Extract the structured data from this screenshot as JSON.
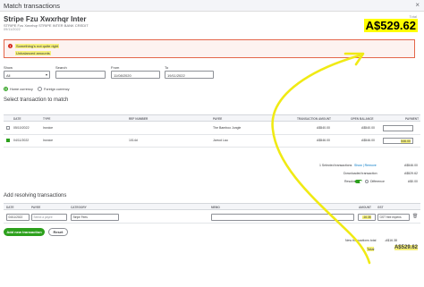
{
  "window": {
    "title": "Match transactions",
    "close": "×"
  },
  "header": {
    "account_title": "Stripe Fzu Xwxrhqr Inter",
    "description": "STRIPE Fzu Xwxrhqr STRIPE INTER BANK CREDIT",
    "date": "09/11/2022",
    "total_label": "Total",
    "total_amount": "A$529.62"
  },
  "alert": {
    "icon": "!",
    "line1": "Something's not quite right",
    "line2": "Unbalanced amounts"
  },
  "filters": {
    "show_label": "Show",
    "show_value": "All",
    "search_label": "Search",
    "search_placeholder": "",
    "from_label": "From",
    "from_value": "11/08/2020",
    "to_label": "To",
    "to_value": "19/11/2022",
    "currency_home": "Home currency",
    "currency_foreign": "Foreign currency"
  },
  "match": {
    "section_title": "Select transaction to match",
    "columns": [
      "DATE",
      "TYPE",
      "REF NUMBER",
      "PAYEE",
      "TRANSACTION AMOUNT",
      "OPEN BALANCE",
      "PAYMENT"
    ],
    "rows": [
      {
        "date": "05/10/2022",
        "type": "Invoice",
        "ref": "",
        "payee": "The Bamboo Jungle",
        "amount": "A$540.00",
        "balance": "A$540.00",
        "payment": "",
        "checked": false
      },
      {
        "date": "04/11/2022",
        "type": "Invoice",
        "ref": "1014d",
        "payee": "Jarrod Lau",
        "amount": "A$546.00",
        "balance": "A$546.00",
        "payment": "546.00",
        "checked": true
      }
    ]
  },
  "match_summary": {
    "selected_label": "1 Selected transactions",
    "selected_links": "Show | Remove",
    "selected_value": "A$546.00",
    "downloaded_label": "Downloaded transaction",
    "downloaded_value": "A$529.62",
    "resolve_label": "Resolve",
    "difference_label": "Difference",
    "difference_value": "A$0.00"
  },
  "resolve": {
    "section_title": "Add resolving transactions",
    "columns": [
      "DATE",
      "PAYEE",
      "CATEGORY",
      "MEMO",
      "AMOUNT",
      "GST"
    ],
    "row": {
      "date": "04/11/2022",
      "payee": "Select a payee",
      "category": "Stripe Fees",
      "memo": "",
      "amount": "-16.38",
      "gst": "GST free expens"
    },
    "add_button": "Add new transaction",
    "reset_button": "Reset",
    "new_total_label": "New transactions total",
    "new_total_value": "-A$16.38",
    "total_label": "Total",
    "total_value": "A$529.62"
  },
  "colors": {
    "accent_green": "#2ca01c",
    "highlight_yellow": "#ffff00",
    "alert_red": "#d52b1e",
    "annotation_yellow": "#f0ea14"
  },
  "icons": {
    "close": "close-icon",
    "alert": "alert-circle-icon",
    "calendar": "calendar-icon",
    "chevron": "chevron-down-icon",
    "delete": "trash-icon"
  }
}
